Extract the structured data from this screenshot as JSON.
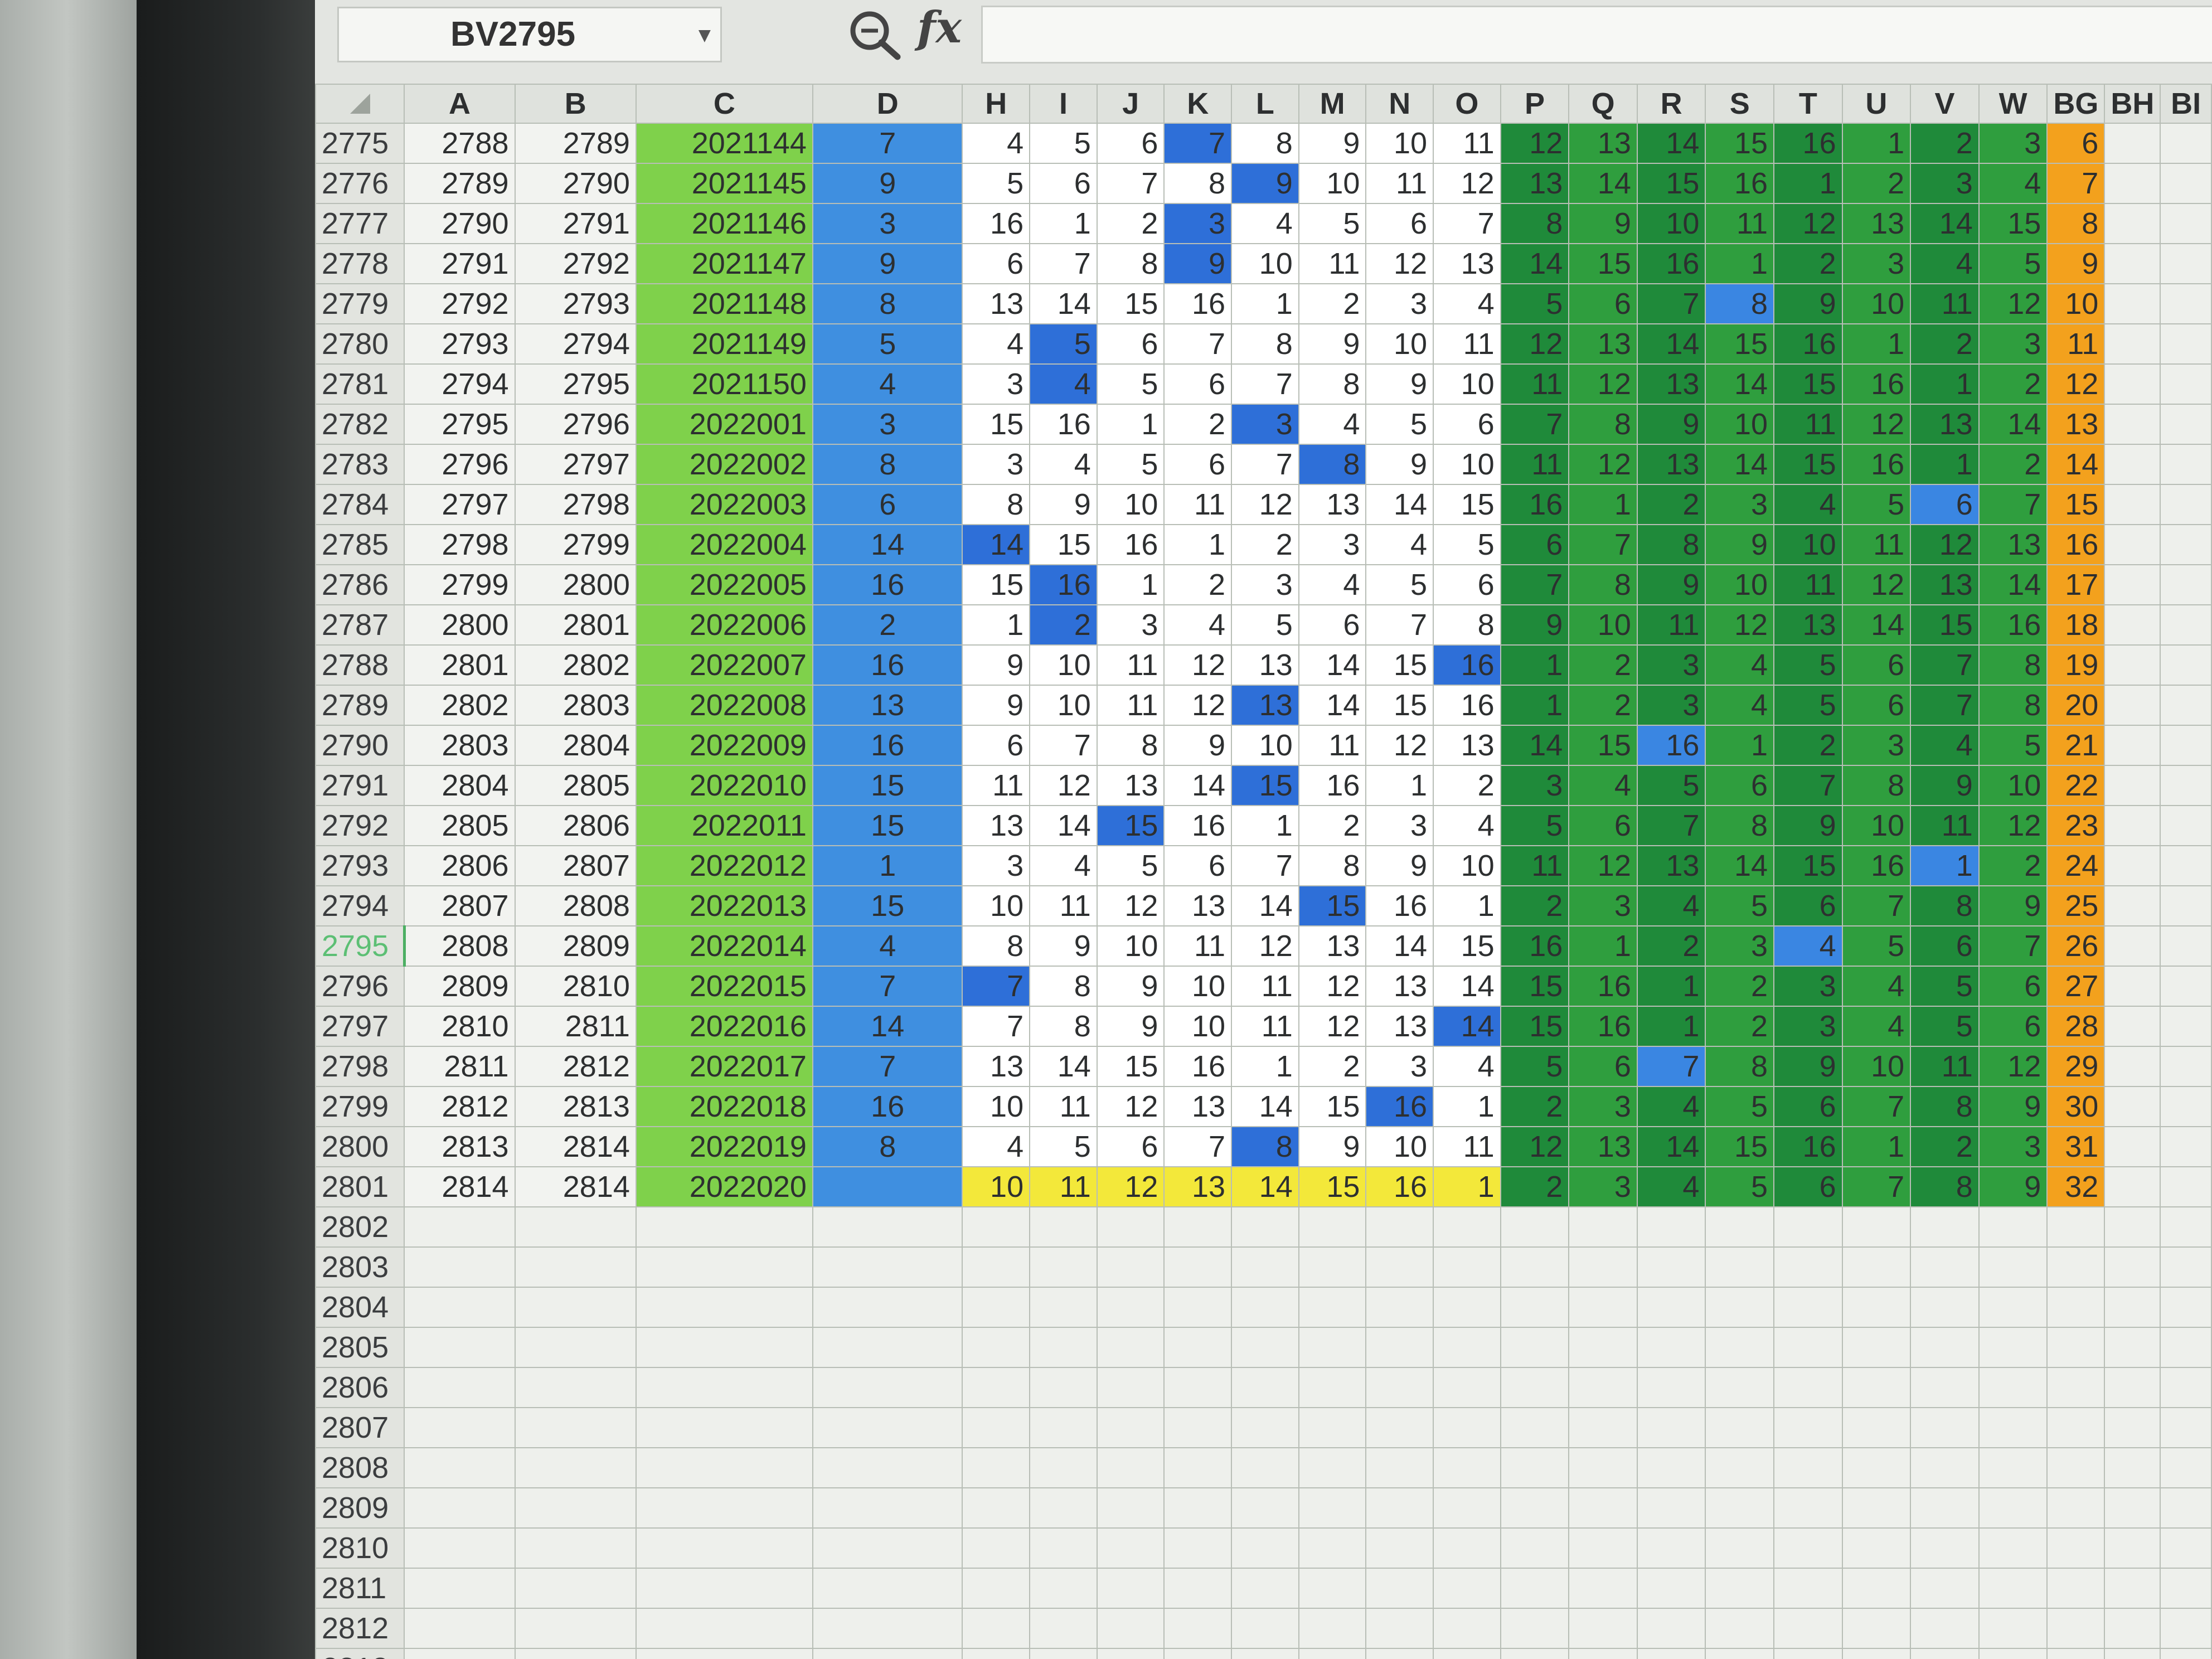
{
  "name_box": {
    "value": "BV2795"
  },
  "formula_bar": {
    "fx_label": "fx",
    "content": ""
  },
  "columns": [
    "A",
    "B",
    "C",
    "D",
    "H",
    "I",
    "J",
    "K",
    "L",
    "M",
    "N",
    "O",
    "P",
    "Q",
    "R",
    "S",
    "T",
    "U",
    "V",
    "W",
    "BG",
    "BH",
    "BI"
  ],
  "active_row": "2795",
  "rows": [
    {
      "num": "2775",
      "A": "2788",
      "B": "2789",
      "C": "2021144",
      "D": "7",
      "H": [
        "4",
        "5",
        "6",
        "7",
        "8",
        "9",
        "10",
        "11"
      ],
      "P": [
        "12",
        "13",
        "14",
        "15",
        "16",
        "1",
        "2",
        "3"
      ],
      "BG": "6",
      "hl": [
        3
      ]
    },
    {
      "num": "2776",
      "A": "2789",
      "B": "2790",
      "C": "2021145",
      "D": "9",
      "H": [
        "5",
        "6",
        "7",
        "8",
        "9",
        "10",
        "11",
        "12"
      ],
      "P": [
        "13",
        "14",
        "15",
        "16",
        "1",
        "2",
        "3",
        "4"
      ],
      "BG": "7",
      "hl": [
        4
      ]
    },
    {
      "num": "2777",
      "A": "2790",
      "B": "2791",
      "C": "2021146",
      "D": "3",
      "H": [
        "16",
        "1",
        "2",
        "3",
        "4",
        "5",
        "6",
        "7"
      ],
      "P": [
        "8",
        "9",
        "10",
        "11",
        "12",
        "13",
        "14",
        "15"
      ],
      "BG": "8",
      "hl": [
        3
      ]
    },
    {
      "num": "2778",
      "A": "2791",
      "B": "2792",
      "C": "2021147",
      "D": "9",
      "H": [
        "6",
        "7",
        "8",
        "9",
        "10",
        "11",
        "12",
        "13"
      ],
      "P": [
        "14",
        "15",
        "16",
        "1",
        "2",
        "3",
        "4",
        "5"
      ],
      "BG": "9",
      "hl": [
        3
      ]
    },
    {
      "num": "2779",
      "A": "2792",
      "B": "2793",
      "C": "2021148",
      "D": "8",
      "H": [
        "13",
        "14",
        "15",
        "16",
        "1",
        "2",
        "3",
        "4"
      ],
      "P": [
        "5",
        "6",
        "7",
        "8",
        "9",
        "10",
        "11",
        "12"
      ],
      "BG": "10",
      "hl": [
        11
      ]
    },
    {
      "num": "2780",
      "A": "2793",
      "B": "2794",
      "C": "2021149",
      "D": "5",
      "H": [
        "4",
        "5",
        "6",
        "7",
        "8",
        "9",
        "10",
        "11"
      ],
      "P": [
        "12",
        "13",
        "14",
        "15",
        "16",
        "1",
        "2",
        "3"
      ],
      "BG": "11",
      "hl": [
        1
      ]
    },
    {
      "num": "2781",
      "A": "2794",
      "B": "2795",
      "C": "2021150",
      "D": "4",
      "H": [
        "3",
        "4",
        "5",
        "6",
        "7",
        "8",
        "9",
        "10"
      ],
      "P": [
        "11",
        "12",
        "13",
        "14",
        "15",
        "16",
        "1",
        "2"
      ],
      "BG": "12",
      "hl": [
        1
      ]
    },
    {
      "num": "2782",
      "A": "2795",
      "B": "2796",
      "C": "2022001",
      "D": "3",
      "H": [
        "15",
        "16",
        "1",
        "2",
        "3",
        "4",
        "5",
        "6"
      ],
      "P": [
        "7",
        "8",
        "9",
        "10",
        "11",
        "12",
        "13",
        "14"
      ],
      "BG": "13",
      "hl": [
        4
      ]
    },
    {
      "num": "2783",
      "A": "2796",
      "B": "2797",
      "C": "2022002",
      "D": "8",
      "H": [
        "3",
        "4",
        "5",
        "6",
        "7",
        "8",
        "9",
        "10"
      ],
      "P": [
        "11",
        "12",
        "13",
        "14",
        "15",
        "16",
        "1",
        "2"
      ],
      "BG": "14",
      "hl": [
        5
      ]
    },
    {
      "num": "2784",
      "A": "2797",
      "B": "2798",
      "C": "2022003",
      "D": "6",
      "H": [
        "8",
        "9",
        "10",
        "11",
        "12",
        "13",
        "14",
        "15"
      ],
      "P": [
        "16",
        "1",
        "2",
        "3",
        "4",
        "5",
        "6",
        "7"
      ],
      "BG": "15",
      "hl": [
        14
      ]
    },
    {
      "num": "2785",
      "A": "2798",
      "B": "2799",
      "C": "2022004",
      "D": "14",
      "H": [
        "14",
        "15",
        "16",
        "1",
        "2",
        "3",
        "4",
        "5"
      ],
      "P": [
        "6",
        "7",
        "8",
        "9",
        "10",
        "11",
        "12",
        "13"
      ],
      "BG": "16",
      "hl": [
        0
      ]
    },
    {
      "num": "2786",
      "A": "2799",
      "B": "2800",
      "C": "2022005",
      "D": "16",
      "H": [
        "15",
        "16",
        "1",
        "2",
        "3",
        "4",
        "5",
        "6"
      ],
      "P": [
        "7",
        "8",
        "9",
        "10",
        "11",
        "12",
        "13",
        "14"
      ],
      "BG": "17",
      "hl": [
        1
      ]
    },
    {
      "num": "2787",
      "A": "2800",
      "B": "2801",
      "C": "2022006",
      "D": "2",
      "H": [
        "1",
        "2",
        "3",
        "4",
        "5",
        "6",
        "7",
        "8"
      ],
      "P": [
        "9",
        "10",
        "11",
        "12",
        "13",
        "14",
        "15",
        "16"
      ],
      "BG": "18",
      "hl": [
        1
      ]
    },
    {
      "num": "2788",
      "A": "2801",
      "B": "2802",
      "C": "2022007",
      "D": "16",
      "H": [
        "9",
        "10",
        "11",
        "12",
        "13",
        "14",
        "15",
        "16"
      ],
      "P": [
        "1",
        "2",
        "3",
        "4",
        "5",
        "6",
        "7",
        "8"
      ],
      "BG": "19",
      "hl": [
        7
      ]
    },
    {
      "num": "2789",
      "A": "2802",
      "B": "2803",
      "C": "2022008",
      "D": "13",
      "H": [
        "9",
        "10",
        "11",
        "12",
        "13",
        "14",
        "15",
        "16"
      ],
      "P": [
        "1",
        "2",
        "3",
        "4",
        "5",
        "6",
        "7",
        "8"
      ],
      "BG": "20",
      "hl": [
        4
      ]
    },
    {
      "num": "2790",
      "A": "2803",
      "B": "2804",
      "C": "2022009",
      "D": "16",
      "H": [
        "6",
        "7",
        "8",
        "9",
        "10",
        "11",
        "12",
        "13"
      ],
      "P": [
        "14",
        "15",
        "16",
        "1",
        "2",
        "3",
        "4",
        "5"
      ],
      "BG": "21",
      "hl": [
        10
      ]
    },
    {
      "num": "2791",
      "A": "2804",
      "B": "2805",
      "C": "2022010",
      "D": "15",
      "H": [
        "11",
        "12",
        "13",
        "14",
        "15",
        "16",
        "1",
        "2"
      ],
      "P": [
        "3",
        "4",
        "5",
        "6",
        "7",
        "8",
        "9",
        "10"
      ],
      "BG": "22",
      "hl": [
        4
      ]
    },
    {
      "num": "2792",
      "A": "2805",
      "B": "2806",
      "C": "2022011",
      "D": "15",
      "H": [
        "13",
        "14",
        "15",
        "16",
        "1",
        "2",
        "3",
        "4"
      ],
      "P": [
        "5",
        "6",
        "7",
        "8",
        "9",
        "10",
        "11",
        "12"
      ],
      "BG": "23",
      "hl": [
        2
      ]
    },
    {
      "num": "2793",
      "A": "2806",
      "B": "2807",
      "C": "2022012",
      "D": "1",
      "H": [
        "3",
        "4",
        "5",
        "6",
        "7",
        "8",
        "9",
        "10"
      ],
      "P": [
        "11",
        "12",
        "13",
        "14",
        "15",
        "16",
        "1",
        "2"
      ],
      "BG": "24",
      "hl": [
        14
      ]
    },
    {
      "num": "2794",
      "A": "2807",
      "B": "2808",
      "C": "2022013",
      "D": "15",
      "H": [
        "10",
        "11",
        "12",
        "13",
        "14",
        "15",
        "16",
        "1"
      ],
      "P": [
        "2",
        "3",
        "4",
        "5",
        "6",
        "7",
        "8",
        "9"
      ],
      "BG": "25",
      "hl": [
        5
      ]
    },
    {
      "num": "2795",
      "A": "2808",
      "B": "2809",
      "C": "2022014",
      "D": "4",
      "H": [
        "8",
        "9",
        "10",
        "11",
        "12",
        "13",
        "14",
        "15"
      ],
      "P": [
        "16",
        "1",
        "2",
        "3",
        "4",
        "5",
        "6",
        "7"
      ],
      "BG": "26",
      "hl": [
        12
      ]
    },
    {
      "num": "2796",
      "A": "2809",
      "B": "2810",
      "C": "2022015",
      "D": "7",
      "H": [
        "7",
        "8",
        "9",
        "10",
        "11",
        "12",
        "13",
        "14"
      ],
      "P": [
        "15",
        "16",
        "1",
        "2",
        "3",
        "4",
        "5",
        "6"
      ],
      "BG": "27",
      "hl": [
        0
      ]
    },
    {
      "num": "2797",
      "A": "2810",
      "B": "2811",
      "C": "2022016",
      "D": "14",
      "H": [
        "7",
        "8",
        "9",
        "10",
        "11",
        "12",
        "13",
        "14"
      ],
      "P": [
        "15",
        "16",
        "1",
        "2",
        "3",
        "4",
        "5",
        "6"
      ],
      "BG": "28",
      "hl": [
        7
      ]
    },
    {
      "num": "2798",
      "A": "2811",
      "B": "2812",
      "C": "2022017",
      "D": "7",
      "H": [
        "13",
        "14",
        "15",
        "16",
        "1",
        "2",
        "3",
        "4"
      ],
      "P": [
        "5",
        "6",
        "7",
        "8",
        "9",
        "10",
        "11",
        "12"
      ],
      "BG": "29",
      "hl": [
        10
      ]
    },
    {
      "num": "2799",
      "A": "2812",
      "B": "2813",
      "C": "2022018",
      "D": "16",
      "H": [
        "10",
        "11",
        "12",
        "13",
        "14",
        "15",
        "16",
        "1"
      ],
      "P": [
        "2",
        "3",
        "4",
        "5",
        "6",
        "7",
        "8",
        "9"
      ],
      "BG": "30",
      "hl": [
        6
      ]
    },
    {
      "num": "2800",
      "A": "2813",
      "B": "2814",
      "C": "2022019",
      "D": "8",
      "H": [
        "4",
        "5",
        "6",
        "7",
        "8",
        "9",
        "10",
        "11"
      ],
      "P": [
        "12",
        "13",
        "14",
        "15",
        "16",
        "1",
        "2",
        "3"
      ],
      "BG": "31",
      "hl": [
        4
      ]
    },
    {
      "num": "2801",
      "A": "2814",
      "B": "2814",
      "C": "2022020",
      "D": "",
      "H": [
        "10",
        "11",
        "12",
        "13",
        "14",
        "15",
        "16",
        "1"
      ],
      "P": [
        "2",
        "3",
        "4",
        "5",
        "6",
        "7",
        "8",
        "9"
      ],
      "BG": "32",
      "hl": [],
      "yellow": true
    }
  ],
  "empty_rows": [
    "2802",
    "2803",
    "2804",
    "2805",
    "2806",
    "2807",
    "2808",
    "2809",
    "2810",
    "2811",
    "2812",
    "2813"
  ],
  "colors": {
    "c_col": "#7fd14b",
    "d_col": "#3f8fe0",
    "green_dark": "#1f8a3a",
    "green": "#2f9e3e",
    "highlight_blue": "#2e6fd8",
    "orange": "#f3a11d",
    "yellow": "#f3e83a"
  }
}
